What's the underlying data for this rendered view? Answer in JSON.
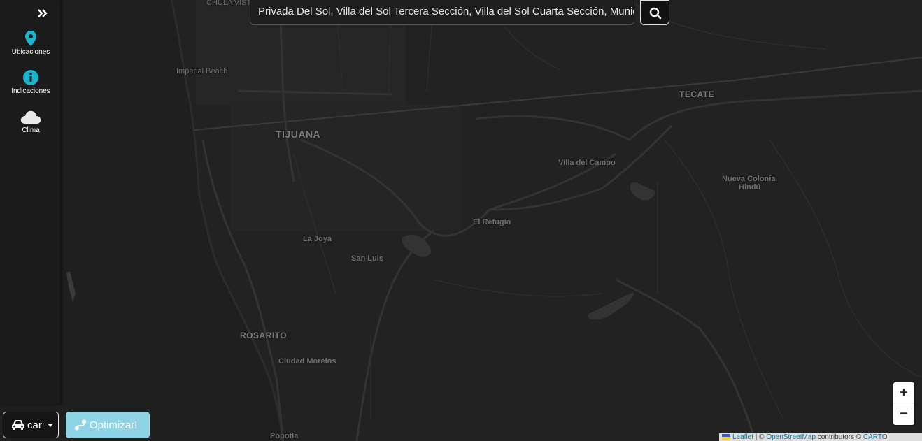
{
  "sidebar": {
    "collapse_icon": "double-chevron-right-icon",
    "items": [
      {
        "label": "Ubicaciones",
        "icon": "map-pin-icon",
        "color": "#1cb5cf"
      },
      {
        "label": "Indicaciones",
        "icon": "info-icon",
        "color": "#1cb5cf"
      },
      {
        "label": "Clima",
        "icon": "cloud-icon",
        "color": "#e8e8e8"
      }
    ]
  },
  "search": {
    "value": "Privada Del Sol, Villa del Sol Tercera Sección, Villa del Sol Cuarta Sección, Municipio de Tijuana",
    "icon": "search-icon"
  },
  "map": {
    "places": [
      {
        "name": "CHULA VISTA"
      },
      {
        "name": "Imperial Beach"
      },
      {
        "name": "TIJUANA"
      },
      {
        "name": "TECATE"
      },
      {
        "name": "Villa del Campo"
      },
      {
        "name": "Nueva Colonia"
      },
      {
        "name": "Hindú"
      },
      {
        "name": "El Refugio"
      },
      {
        "name": "La Joya"
      },
      {
        "name": "San Luis"
      },
      {
        "name": "ROSARITO"
      },
      {
        "name": "Ciudad Morelos"
      },
      {
        "name": "Popotla"
      }
    ],
    "zoom_in": "+",
    "zoom_out": "−",
    "attribution": {
      "leaflet": "Leaflet",
      "sep": " | © ",
      "osm": "OpenStreetMap",
      "contributors": " contributors © ",
      "carto": "CARTO"
    }
  },
  "controls": {
    "vehicle": {
      "label": "car",
      "icon": "car-icon"
    },
    "optimize": {
      "label": "Optimizar!",
      "icon": "route-icon",
      "color": "#8ed4e6"
    }
  }
}
